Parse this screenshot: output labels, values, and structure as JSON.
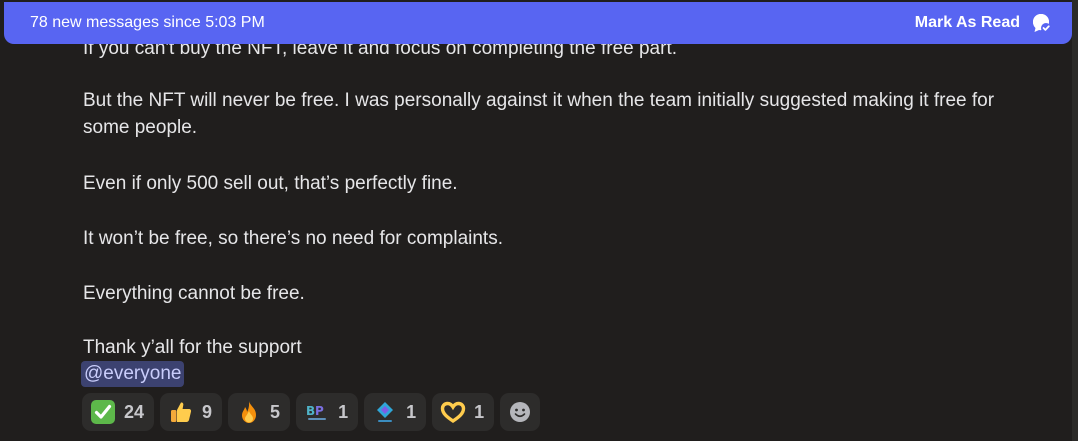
{
  "banner": {
    "text": "78 new messages since 5:03 PM",
    "action_label": "Mark As Read",
    "action_icon": "mark-read-icon"
  },
  "message": {
    "lines": [
      "If you can't buy the NFT, leave it and focus on completing the free part.",
      "But the NFT will never be free. I was personally against it when the team initially suggested making it free for",
      "some people.",
      "Even if only 500 sell out, that’s perfectly fine.",
      "It won’t be free, so there’s no need for complaints.",
      "Everything cannot be free.",
      "Thank y’all for the support"
    ],
    "mention": "@everyone"
  },
  "reactions": [
    {
      "icon": "check-mark-emoji",
      "count": "24"
    },
    {
      "icon": "thumbs-up-emoji",
      "count": "9"
    },
    {
      "icon": "fire-emoji",
      "count": "5"
    },
    {
      "icon": "betpol-logo-emoji",
      "count": "1"
    },
    {
      "icon": "betpol-diamond-emoji",
      "count": "1"
    },
    {
      "icon": "heart-hands-emoji",
      "count": "1"
    }
  ],
  "colors": {
    "banner": "#5865f2",
    "background": "#201e1d",
    "mention_bg": "#3c4270",
    "reaction_bg": "#2d2c2b"
  }
}
